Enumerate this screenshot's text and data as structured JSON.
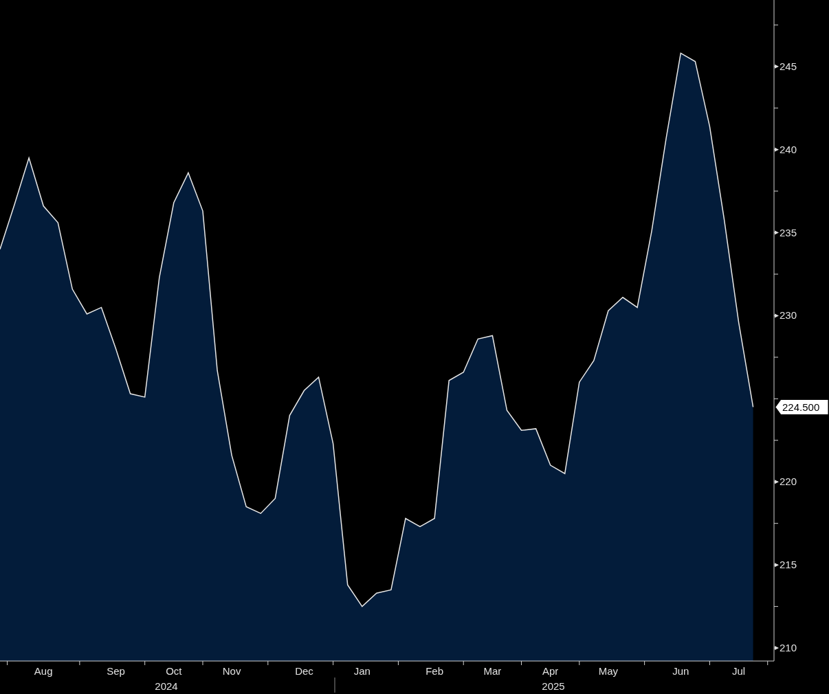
{
  "chart_data": {
    "type": "area",
    "categories": [
      null,
      null,
      null,
      "Aug",
      null,
      null,
      null,
      null,
      "Sep",
      null,
      null,
      null,
      "Oct",
      null,
      null,
      null,
      "Nov",
      null,
      null,
      null,
      null,
      "Dec",
      null,
      null,
      null,
      "Jan",
      null,
      null,
      null,
      null,
      "Feb",
      null,
      null,
      null,
      "Mar",
      null,
      null,
      null,
      "Apr",
      null,
      null,
      null,
      "May",
      null,
      null,
      null,
      null,
      "Jun",
      null,
      null,
      null,
      "Jul",
      null
    ],
    "series": [
      {
        "color": "#e8e8e8",
        "values": [
          234.0,
          236.7,
          239.5,
          236.6,
          235.6,
          231.6,
          230.1,
          230.5,
          228.0,
          225.3,
          225.1,
          232.3,
          236.8,
          238.6,
          236.3,
          226.7,
          221.6,
          218.5,
          218.1,
          219.0,
          224.0,
          225.5,
          226.3,
          222.3,
          213.8,
          212.5,
          213.3,
          213.5,
          217.8,
          217.3,
          217.8,
          226.1,
          226.6,
          228.6,
          228.8,
          224.3,
          223.1,
          223.2,
          221.0,
          220.5,
          226.0,
          227.3,
          230.3,
          231.1,
          230.5,
          235.1,
          240.7,
          245.8,
          245.3,
          241.4,
          235.8,
          229.6,
          224.5
        ]
      }
    ],
    "ylim": [
      209.3,
      249.0
    ],
    "yticks": [
      210,
      215,
      220,
      230,
      235,
      240,
      245
    ],
    "annotations": [
      "224.500"
    ]
  },
  "year_labels": [
    "2024",
    "2025"
  ]
}
